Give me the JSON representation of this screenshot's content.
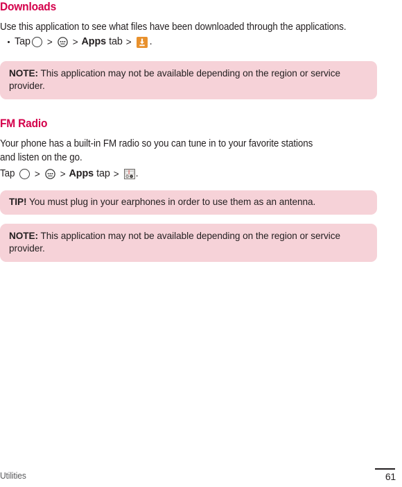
{
  "page": {
    "footer_section": "Utilities",
    "page_number": "61",
    "heading_color": "#d4004b",
    "callout_bg": "#f6d2d8",
    "download_icon_color": "#e8912d",
    "text_color": "#231f20"
  },
  "sections": [
    {
      "id": "downloads",
      "heading": "Downloads",
      "intro": "Use this application to see what files have been downloaded through the applications.",
      "steps": {
        "tap_label": "Tap",
        "sep": ">",
        "apps_label": "Apps",
        "tab_word": "tab",
        "period": ".",
        "icons": [
          "home-circle-icon",
          "apps-grid-icon",
          "downloads-app-icon"
        ]
      },
      "callouts": [
        {
          "id": "downloads-note",
          "label": "NOTE:",
          "text": " This application may not be available depending on the region or service provider."
        }
      ]
    },
    {
      "id": "fm-radio",
      "heading": "FM Radio",
      "intro": "Your phone has a built-in FM radio so you can tune in to your favorite stations and listen on the go.",
      "steps": {
        "tap_label": "Tap",
        "sep": ">",
        "apps_label": "Apps",
        "tab_word": "tap",
        "period": ".",
        "icons": [
          "home-circle-icon",
          "apps-grid-icon",
          "fm-radio-app-icon"
        ]
      },
      "callouts": [
        {
          "id": "fm-radio-tip",
          "label": "TIP!",
          "text": " You must plug in your earphones in order to use them as an antenna."
        },
        {
          "id": "fm-radio-note",
          "label": "NOTE:",
          "text": " This application may not be available depending on the region or service provider."
        }
      ]
    }
  ]
}
